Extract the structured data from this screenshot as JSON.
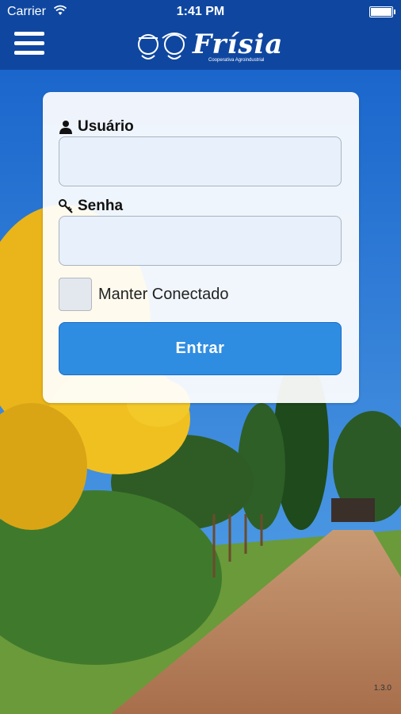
{
  "status_bar": {
    "carrier": "Carrier",
    "time": "1:41 PM"
  },
  "nav": {
    "menu_icon": "hamburger-menu-icon",
    "logo_text": "Frísia",
    "logo_tagline": "Cooperativa Agroindustrial"
  },
  "form": {
    "username_label": "Usuário",
    "username_icon": "user-icon",
    "username_value": "",
    "password_label": "Senha",
    "password_icon": "key-icon",
    "password_value": "",
    "remember_label": "Manter Conectado",
    "remember_checked": false,
    "submit_label": "Entrar"
  },
  "footer": {
    "version": "1.3.0"
  },
  "colors": {
    "navbar": "#0f47a0",
    "button": "#2f8de1",
    "sky": "#1d6fd0"
  }
}
